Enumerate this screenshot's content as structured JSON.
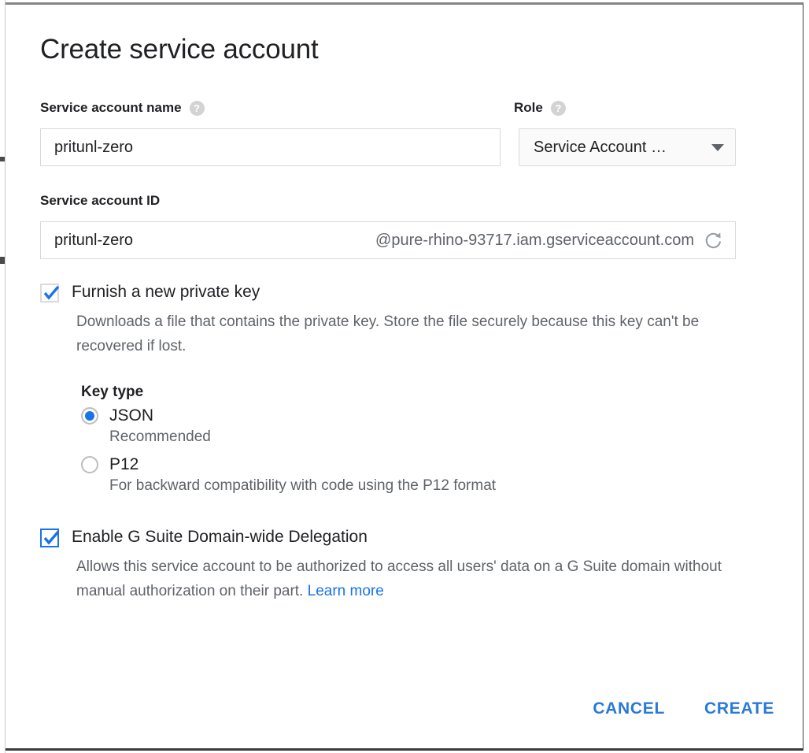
{
  "dialog": {
    "title": "Create service account"
  },
  "fields": {
    "name": {
      "label": "Service account name",
      "help_icon": "help-circle-icon",
      "value": "pritunl-zero",
      "placeholder": ""
    },
    "role": {
      "label": "Role",
      "help_icon": "help-circle-icon",
      "selected": "Service Account …",
      "caret_icon": "chevron-down-icon"
    },
    "account_id": {
      "label": "Service account ID",
      "value": "pritunl-zero",
      "suffix": "@pure-rhino-93717.iam.gserviceaccount.com",
      "refresh_icon": "refresh-icon",
      "placeholder": ""
    }
  },
  "private_key": {
    "checkbox_label": "Furnish a new private key",
    "checked": true,
    "description": "Downloads a file that contains the private key. Store the file securely because this key can't be recovered if lost.",
    "key_type": {
      "title": "Key type",
      "options": [
        {
          "label": "JSON",
          "sub": "Recommended",
          "selected": true
        },
        {
          "label": "P12",
          "sub": "For backward compatibility with code using the P12 format",
          "selected": false
        }
      ]
    }
  },
  "delegation": {
    "checkbox_label": "Enable G Suite Domain-wide Delegation",
    "checked": true,
    "description_part1": "Allows this service account to be authorized to access all users' data on a G Suite domain without manual authorization on their part. ",
    "link_label": "Learn more"
  },
  "actions": {
    "cancel_label": "CANCEL",
    "create_label": "CREATE"
  },
  "colors": {
    "accent": "#1a73e8",
    "action": "#2979d8",
    "text_primary": "#202124",
    "text_secondary": "#5f6368",
    "border": "#d8d8d8"
  }
}
